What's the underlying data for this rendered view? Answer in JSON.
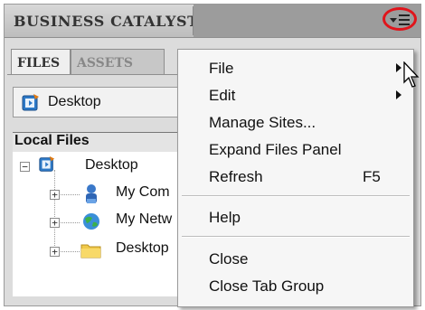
{
  "panel": {
    "title": "BUSINESS CATALYST",
    "tabs": [
      "FILES",
      "ASSETS"
    ],
    "location": "Desktop",
    "local_files_header": "Local Files"
  },
  "tree": {
    "root": "Desktop",
    "children": [
      "My Com",
      "My Netw",
      "Desktop"
    ]
  },
  "menu": {
    "items": [
      {
        "label": "File",
        "submenu": true
      },
      {
        "label": "Edit",
        "submenu": true
      },
      {
        "label": "Manage Sites...",
        "submenu": false
      },
      {
        "label": "Expand Files Panel",
        "submenu": false
      },
      {
        "label": "Refresh",
        "shortcut": "F5"
      },
      {
        "label": "Help"
      },
      {
        "label": "Close"
      },
      {
        "label": "Close Tab Group"
      }
    ]
  },
  "colors": {
    "highlight_ring": "#e0141b",
    "panel_bg": "#dcdcdc",
    "menu_bg": "#f6f6f6"
  },
  "icons": [
    "panel-options-icon",
    "site-icon",
    "computer-icon",
    "network-icon",
    "folder-icon",
    "submenu-arrow-icon",
    "mouse-cursor-icon"
  ]
}
